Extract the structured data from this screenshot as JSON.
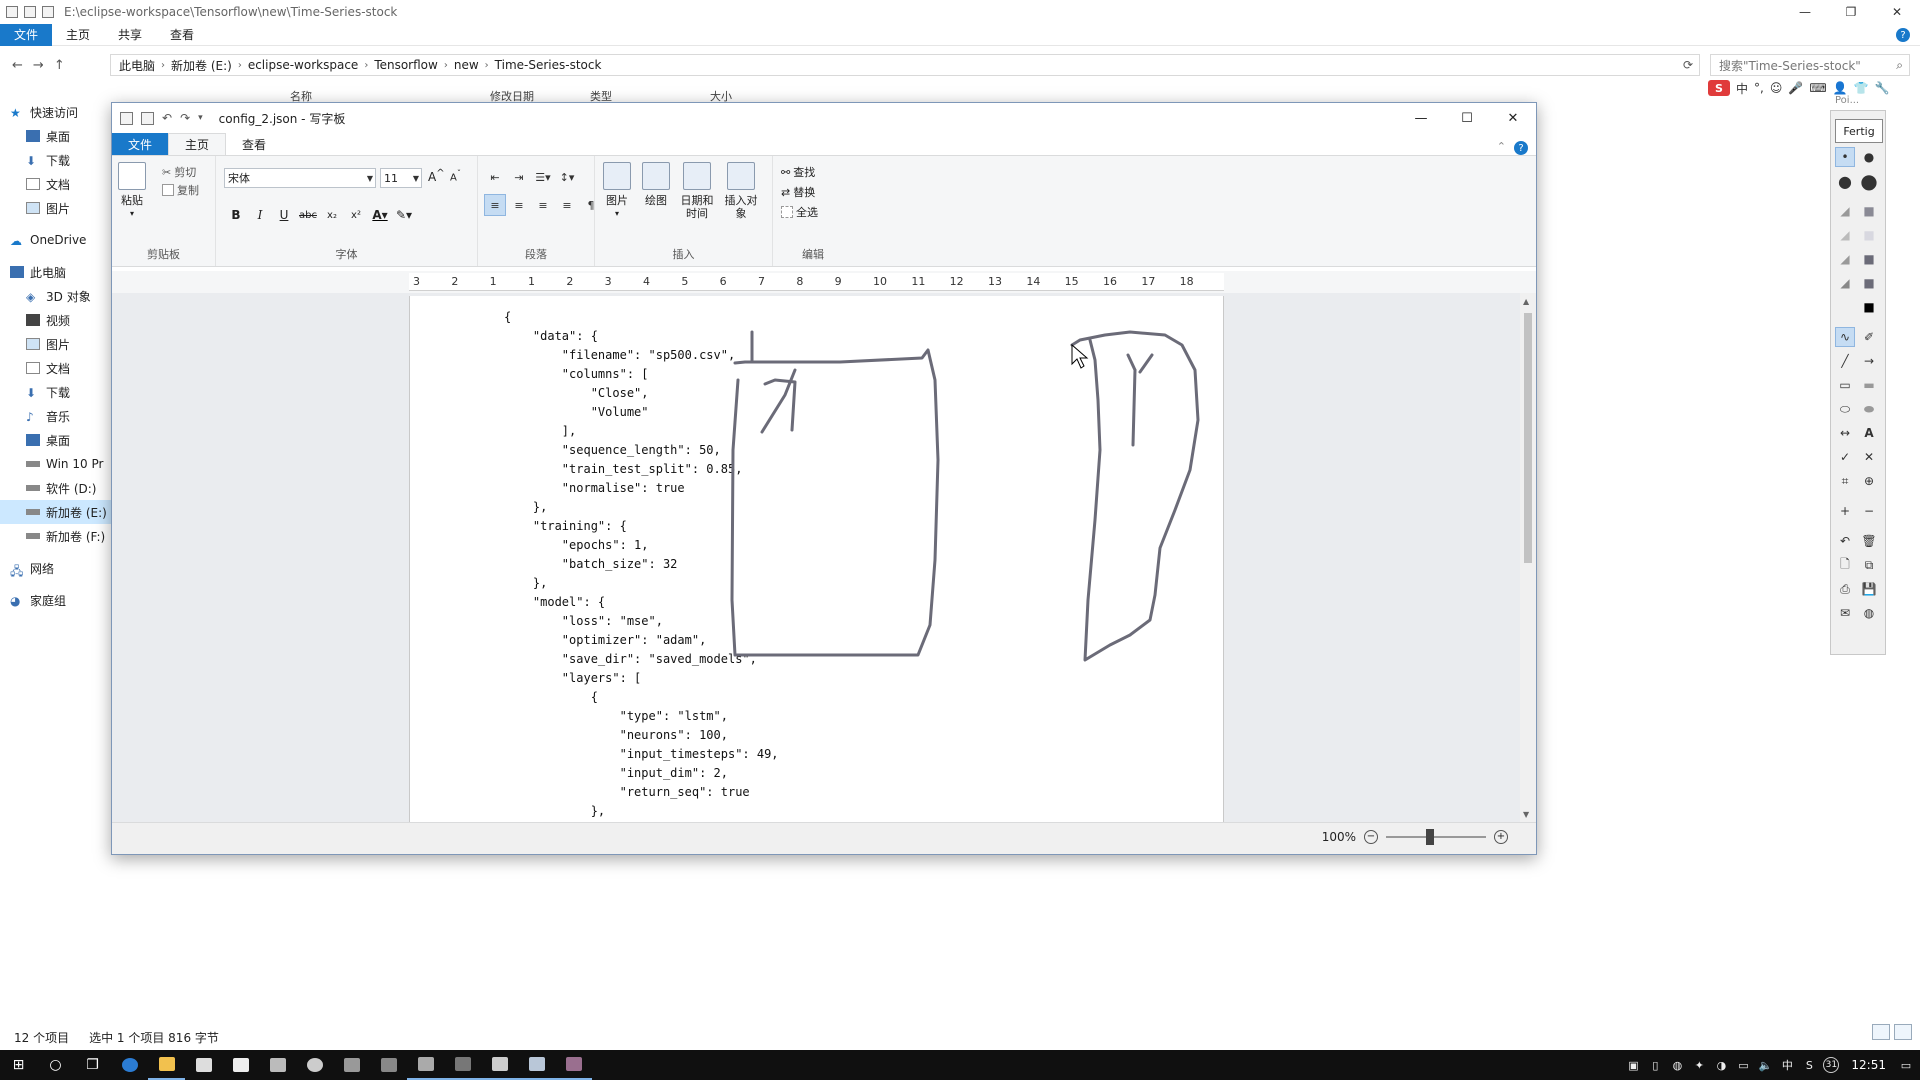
{
  "explorer": {
    "title_path": "E:\\eclipse-workspace\\Tensorflow\\new\\Time-Series-stock",
    "tabs": [
      "文件",
      "主页",
      "共享",
      "查看"
    ],
    "breadcrumb": [
      "此电脑",
      "新加卷 (E:)",
      "eclipse-workspace",
      "Tensorflow",
      "new",
      "Time-Series-stock"
    ],
    "search_placeholder": "搜索\"Time-Series-stock\"",
    "columns": [
      "名称",
      "修改日期",
      "类型",
      "大小"
    ],
    "nav": [
      {
        "label": "快速访问",
        "level": 1
      },
      {
        "label": "桌面",
        "level": 2
      },
      {
        "label": "下载",
        "level": 2
      },
      {
        "label": "文档",
        "level": 2
      },
      {
        "label": "图片",
        "level": 2
      },
      {
        "label": "OneDrive",
        "level": 1
      },
      {
        "label": "此电脑",
        "level": 1
      },
      {
        "label": "3D 对象",
        "level": 2
      },
      {
        "label": "视频",
        "level": 2
      },
      {
        "label": "图片",
        "level": 2
      },
      {
        "label": "文档",
        "level": 2
      },
      {
        "label": "下载",
        "level": 2
      },
      {
        "label": "音乐",
        "level": 2
      },
      {
        "label": "桌面",
        "level": 2
      },
      {
        "label": "Win 10 Pr",
        "level": 2
      },
      {
        "label": "软件 (D:)",
        "level": 2
      },
      {
        "label": "新加卷 (E:)",
        "level": 2,
        "selected": true
      },
      {
        "label": "新加卷 (F:)",
        "level": 2
      },
      {
        "label": "网络",
        "level": 1
      },
      {
        "label": "家庭组",
        "level": 1
      }
    ],
    "status": {
      "count": "12 个项目",
      "selected": "选中 1 个项目  816 字节"
    }
  },
  "wordpad": {
    "title": "config_2.json - 写字板",
    "tabs": [
      "文件",
      "主页",
      "查看"
    ],
    "clipboard": {
      "paste": "粘贴",
      "cut": "剪切",
      "copy": "复制",
      "label": "剪贴板"
    },
    "font": {
      "name": "宋体",
      "size": "11",
      "label": "字体"
    },
    "paragraph": {
      "label": "段落"
    },
    "insert": {
      "picture": "图片",
      "paint": "绘图",
      "datetime": "日期和时间",
      "object": "插入对象",
      "label": "插入"
    },
    "editing": {
      "find": "查找",
      "replace": "替换",
      "select_all": "全选",
      "label": "编辑"
    },
    "ruler": [
      "3",
      "2",
      "1",
      "1",
      "2",
      "3",
      "4",
      "5",
      "6",
      "7",
      "8",
      "9",
      "10",
      "11",
      "12",
      "13",
      "14",
      "15",
      "16",
      "17",
      "18"
    ],
    "zoom": "100%",
    "document_lines": [
      "{",
      "    \"data\": {",
      "        \"filename\": \"sp500.csv\",",
      "        \"columns\": [",
      "            \"Close\",",
      "            \"Volume\"",
      "        ],",
      "        \"sequence_length\": 50,",
      "        \"train_test_split\": 0.85,",
      "        \"normalise\": true",
      "    },",
      "    \"training\": {",
      "        \"epochs\": 1,",
      "        \"batch_size\": 32",
      "    },",
      "    \"model\": {",
      "        \"loss\": \"mse\",",
      "        \"optimizer\": \"adam\",",
      "        \"save_dir\": \"saved_models\",",
      "        \"layers\": [",
      "            {",
      "                \"type\": \"lstm\",",
      "                \"neurons\": 100,",
      "                \"input_timesteps\": 49,",
      "                \"input_dim\": 2,",
      "                \"return_seq\": true",
      "            },"
    ]
  },
  "toolbox": {
    "header": "Poi...",
    "done": "Fertig"
  },
  "taskbar": {
    "time": "12:51",
    "ime": "中",
    "day": "31"
  },
  "colors": {
    "accent": "#1979ca",
    "ink": "#6b6b78",
    "selected_nav": "#cce8ff"
  }
}
